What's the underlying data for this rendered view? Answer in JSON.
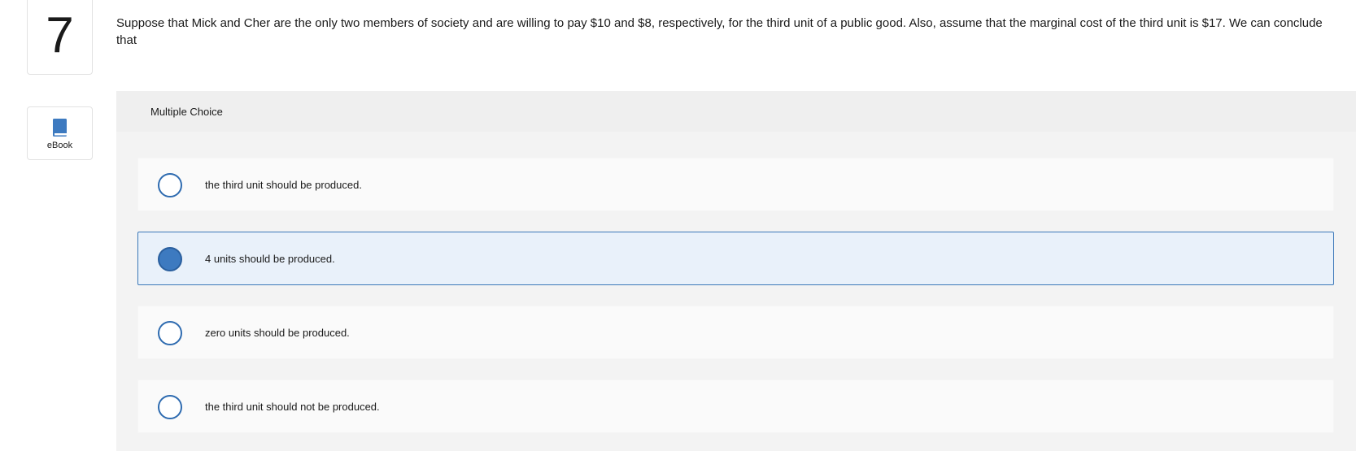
{
  "question": {
    "number": "7",
    "text": "Suppose that Mick and Cher are the only two members of society and are willing to pay $10 and $8, respectively, for the third unit of a public good. Also, assume that the marginal cost of the third unit is $17. We can conclude that"
  },
  "ebook": {
    "label": "eBook",
    "icon": "book-icon"
  },
  "multiple_choice": {
    "header": "Multiple Choice",
    "options": [
      {
        "label": "the third unit should be produced.",
        "selected": false
      },
      {
        "label": "4 units should be produced.",
        "selected": true
      },
      {
        "label": "zero units should be produced.",
        "selected": false
      },
      {
        "label": "the third unit should not be produced.",
        "selected": false
      }
    ]
  },
  "colors": {
    "accent": "#3d7ac0",
    "selected_bg": "#e9f1fa",
    "panel_bg": "#f1f1f1"
  }
}
